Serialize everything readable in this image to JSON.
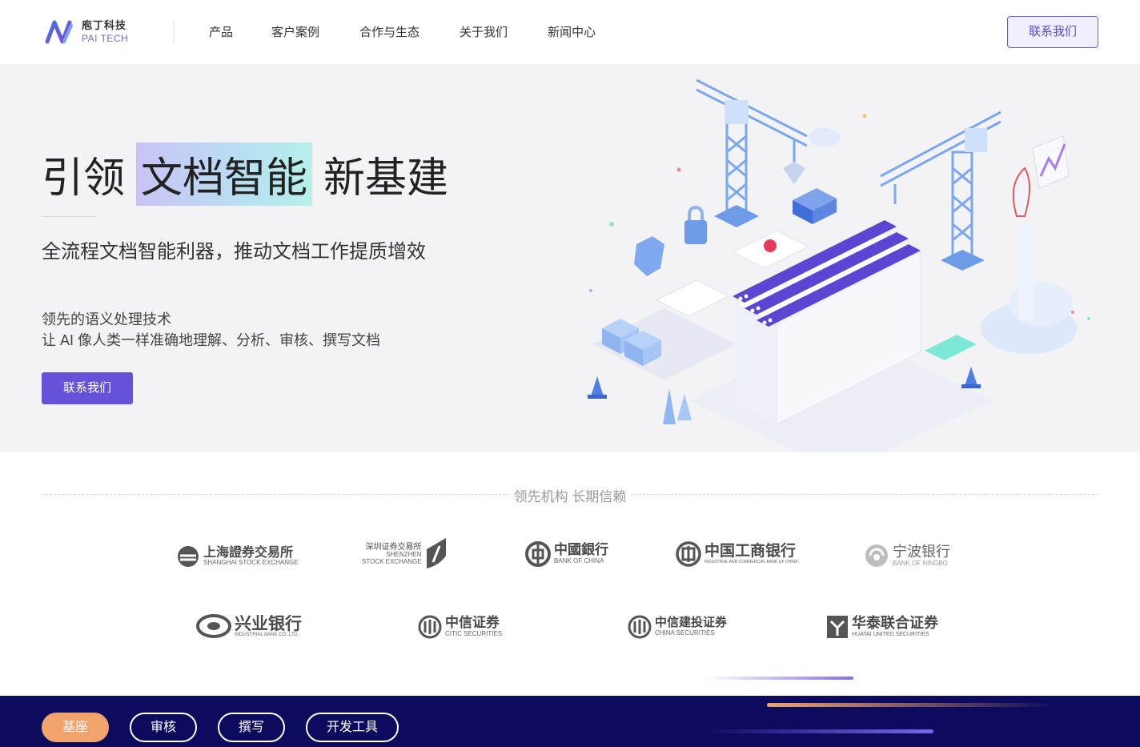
{
  "header": {
    "logo_cn": "庖丁科技",
    "logo_en": "PAI TECH",
    "nav": [
      "产品",
      "客户案例",
      "合作与生态",
      "关于我们",
      "新闻中心"
    ],
    "contact_label": "联系我们"
  },
  "hero": {
    "title_pre": "引领",
    "title_highlight": "文档智能",
    "title_post": "新基建",
    "subtitle": "全流程文档智能利器，推动文档工作提质增效",
    "desc_line1": "领先的语义处理技术",
    "desc_line2": "让 AI 像人类一样准确地理解、分析、审核、撰写文档",
    "button_label": "联系我们"
  },
  "partners": {
    "title": "领先机构 长期信赖",
    "row1": [
      {
        "cn": "上海證券交易所",
        "en": "SHANGHAI STOCK EXCHANGE"
      },
      {
        "cn": "深圳证券交易所",
        "en1": "SHENZHEN",
        "en2": "STOCK EXCHANGE"
      },
      {
        "cn": "中國銀行",
        "en": "BANK OF CHINA"
      },
      {
        "cn": "中国工商银行",
        "en": "INDUSTRIAL AND COMMERCIAL BANK OF CHINA"
      },
      {
        "cn": "宁波银行",
        "en": "BANK OF NINGBO"
      }
    ],
    "row2": [
      {
        "cn": "兴业银行",
        "en": "INDUSTRIAL BANK CO.,LTD."
      },
      {
        "cn": "中信证券",
        "en": "CITIC SECURITIES"
      },
      {
        "cn": "中信建投证券",
        "en": "CHINA SECURITIES"
      },
      {
        "cn": "华泰联合证券",
        "en": "HUATAI UNITED SECURITIES"
      }
    ]
  },
  "bottom_tabs": [
    "基座",
    "审核",
    "撰写",
    "开发工具"
  ],
  "colors": {
    "primary": "#6552d9",
    "bottom_bg": "#0c0b5e",
    "active_tab": "#f2a36c",
    "hero_bg": "#f3f3f5"
  }
}
